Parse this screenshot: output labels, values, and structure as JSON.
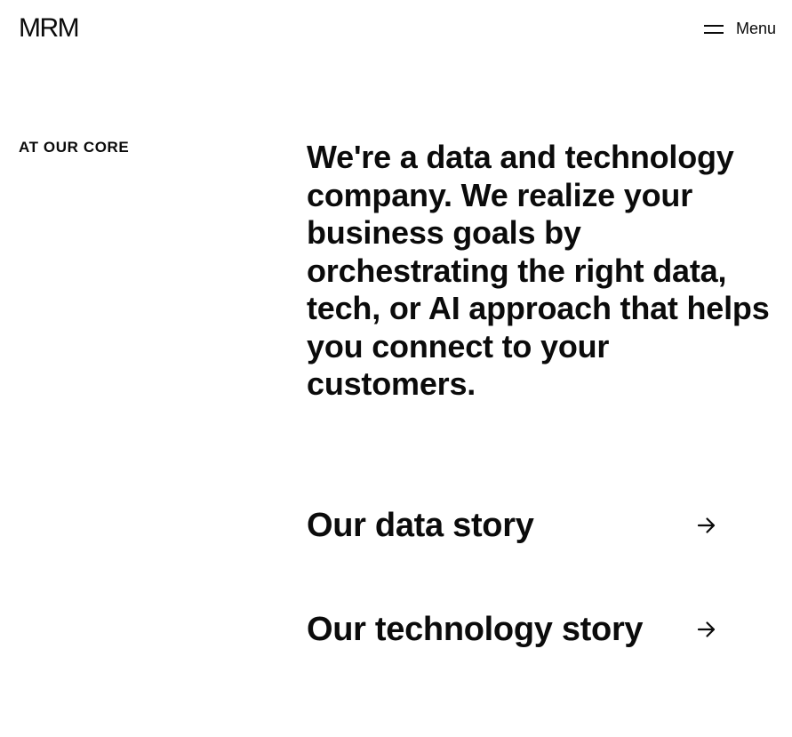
{
  "header": {
    "logo_text": "MRM",
    "menu_label": "Menu"
  },
  "icons": {
    "menu": "hamburger-menu-icon",
    "link_arrow": "arrow-right-icon"
  },
  "main": {
    "section_label": "AT OUR CORE",
    "headline": "We're a data and technology company. We realize your business goals by orchestrating the right data, tech, or AI approach that helps you connect to your customers.",
    "links": [
      {
        "label": "Our data story"
      },
      {
        "label": "Our technology story"
      }
    ]
  },
  "colors": {
    "text": "#0b0b0b",
    "background": "#ffffff"
  }
}
